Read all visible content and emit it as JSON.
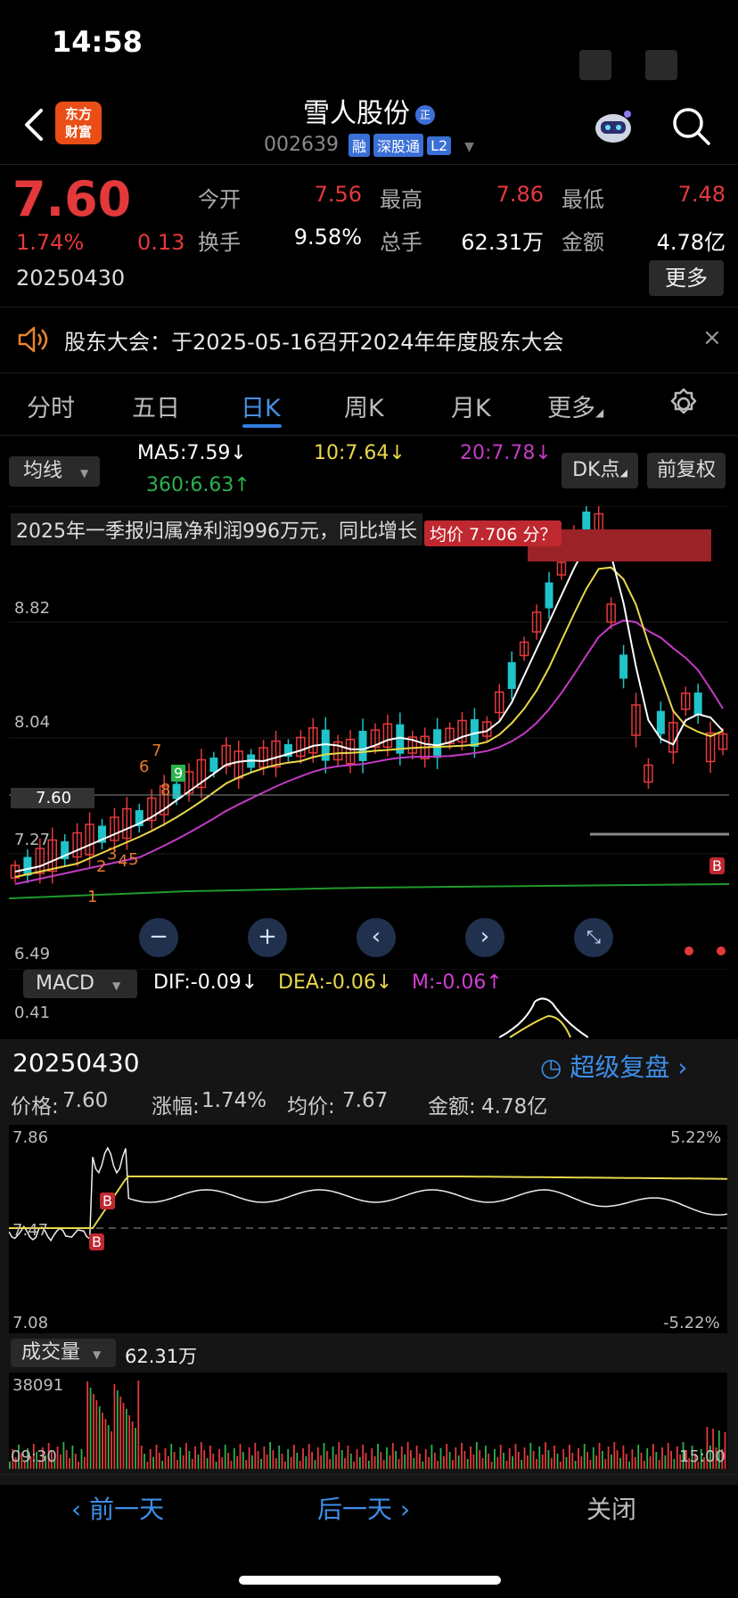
{
  "status": {
    "time": "14:58"
  },
  "header": {
    "logo_text_1": "东方",
    "logo_text_2": "财富",
    "name": "雪人股份",
    "name_badge": "正",
    "code": "002639",
    "tags": [
      "融",
      "深股通",
      "L2"
    ]
  },
  "quote": {
    "price": "7.60",
    "pct": "1.74%",
    "change": "0.13",
    "date": "20250430",
    "open_label": "今开",
    "open": "7.56",
    "high_label": "最高",
    "high": "7.86",
    "low_label": "最低",
    "low": "7.48",
    "turnover_label": "换手",
    "turnover": "9.58%",
    "volume_label": "总手",
    "volume": "62.31万",
    "amount_label": "金额",
    "amount": "4.78亿",
    "more": "更多"
  },
  "notice": {
    "text": "股东大会：于2025-05-16召开2024年年度股东大会"
  },
  "tabs": [
    "分时",
    "五日",
    "日K",
    "周K",
    "月K",
    "更多"
  ],
  "ma_bar": {
    "select": "均线",
    "ma5": "MA5:7.59↓",
    "ma10": "10:7.64↓",
    "ma20": "20:7.78↓",
    "ma360": "360:6.63↑",
    "dk": "DK点",
    "fq": "前复权"
  },
  "kline": {
    "banner": "2025年一季报归属净利润996万元，同比增长",
    "avg_tip": "均价 7.706 分？",
    "y_labels": [
      "8.82",
      "8.04",
      "7.60",
      "7.27",
      "6.49"
    ],
    "counts": [
      "1",
      "2",
      "3",
      "4",
      "5",
      "6",
      "7",
      "8",
      "9"
    ],
    "b_mark": "B",
    "colors": {
      "up": "#e4393c",
      "down": "#1fc3c8",
      "ma5": "#ffffff",
      "ma10": "#e8d84a",
      "ma20": "#c23bc4",
      "ma360": "#1f9a2c"
    }
  },
  "macd": {
    "select": "MACD",
    "dif": "DIF:-0.09↓",
    "dea": "DEA:-0.06↓",
    "m": "M:-0.06↑",
    "y_label": "0.41"
  },
  "day_panel": {
    "date": "20250430",
    "replay": "超级复盘",
    "price_label": "价格:",
    "price": "7.60",
    "pct_label": "涨幅:",
    "pct": "1.74%",
    "avg_label": "均价:",
    "avg": "7.67",
    "amount_label": "金额:",
    "amount": "4.78亿",
    "top": "7.86",
    "mid": "7.47",
    "bottom": "7.08",
    "top_pct": "5.22%",
    "bottom_pct": "-5.22%",
    "vol_select": "成交量",
    "vol_total": "62.31万",
    "vol_max": "38091",
    "t_start": "09:30",
    "t_end": "15:00"
  },
  "bottom_bar": {
    "prev": "前一天",
    "next": "后一天",
    "close": "关闭"
  }
}
